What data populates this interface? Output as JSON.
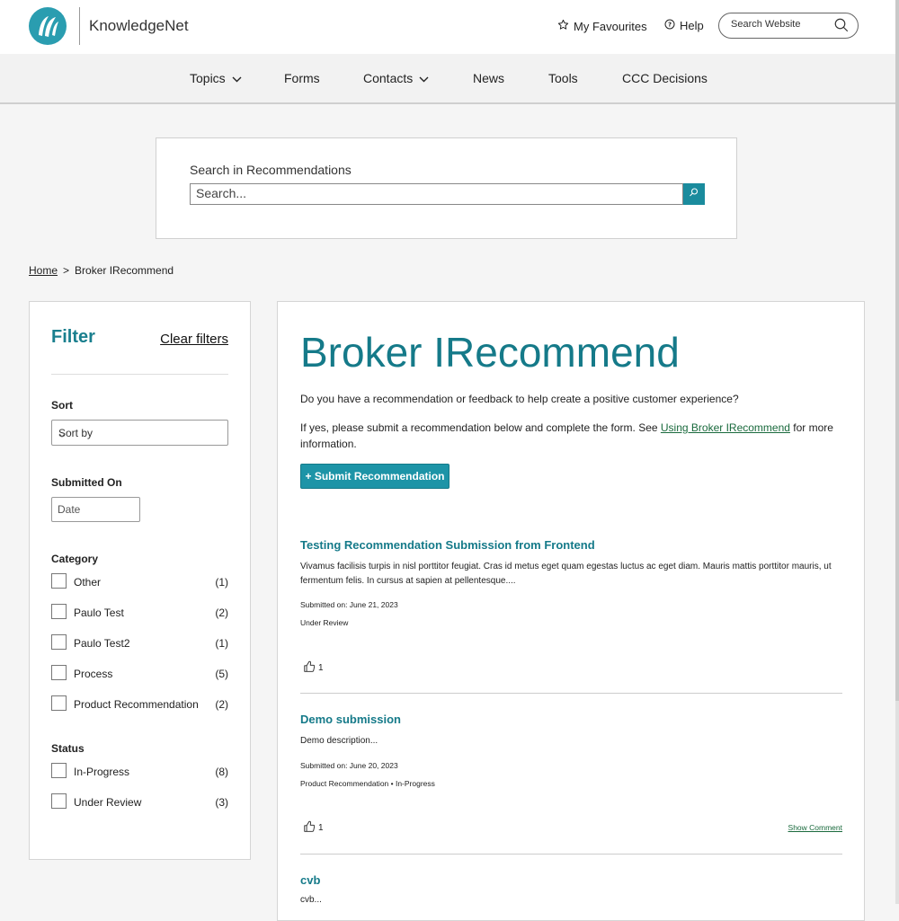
{
  "header": {
    "brand": "KnowledgeNet",
    "favourites": "My Favourites",
    "help": "Help",
    "search_placeholder": "Search Website"
  },
  "nav": [
    {
      "label": "Topics"
    },
    {
      "label": "Forms"
    },
    {
      "label": "Contacts"
    },
    {
      "label": "News"
    },
    {
      "label": "Tools"
    },
    {
      "label": "CCC Decisions"
    }
  ],
  "search": {
    "label": "Search in Recommendations",
    "placeholder": "Search..."
  },
  "breadcrumb": {
    "home": "Home",
    "separator": ">",
    "current": "Broker IRecommend"
  },
  "filter": {
    "title": "Filter",
    "clear": "Clear filters",
    "sort_heading": "Sort",
    "sort_value": "Sort by",
    "submitted_heading": "Submitted On",
    "date_placeholder": "Date",
    "category_heading": "Category",
    "categories": [
      {
        "label": "Other",
        "count": "(1)"
      },
      {
        "label": "Paulo Test",
        "count": "(2)"
      },
      {
        "label": "Paulo Test2",
        "count": "(1)"
      },
      {
        "label": "Process",
        "count": "(5)"
      },
      {
        "label": "Product Recommendation",
        "count": "(2)"
      }
    ],
    "status_heading": "Status",
    "statuses": [
      {
        "label": "In-Progress",
        "count": "(8)"
      },
      {
        "label": "Under Review",
        "count": "(3)"
      }
    ]
  },
  "main": {
    "title": "Broker IRecommend",
    "intro1": "Do you have a recommendation or feedback to help create a positive customer experience?",
    "intro2_before": "If yes, please submit a recommendation below and complete the form. See ",
    "intro2_link": "Using Broker IRecommend",
    "intro2_after": " for more information.",
    "submit_label": "+ Submit Recommendation",
    "recommendations": [
      {
        "title": "Testing Recommendation Submission from Frontend",
        "description": "Vivamus facilisis turpis in nisl porttitor feugiat. Cras id metus eget quam egestas luctus ac eget diam. Mauris mattis porttitor mauris, ut fermentum felis. In cursus at sapien at pellentesque....",
        "submitted": "Submitted on: June 21, 2023",
        "tags": "Under Review",
        "likes": "1",
        "comment": ""
      },
      {
        "title": "Demo submission",
        "description": "Demo description...",
        "submitted": "Submitted on: June 20, 2023",
        "tags": "Product Recommendation • In-Progress",
        "likes": "1",
        "comment": "Show Comment"
      },
      {
        "title": "cvb",
        "description": "cvb...",
        "submitted": "",
        "tags": "",
        "likes": "",
        "comment": ""
      }
    ]
  },
  "colors": {
    "accent": "#157a89",
    "button": "#1d94a7",
    "link": "#1a6a3d"
  }
}
